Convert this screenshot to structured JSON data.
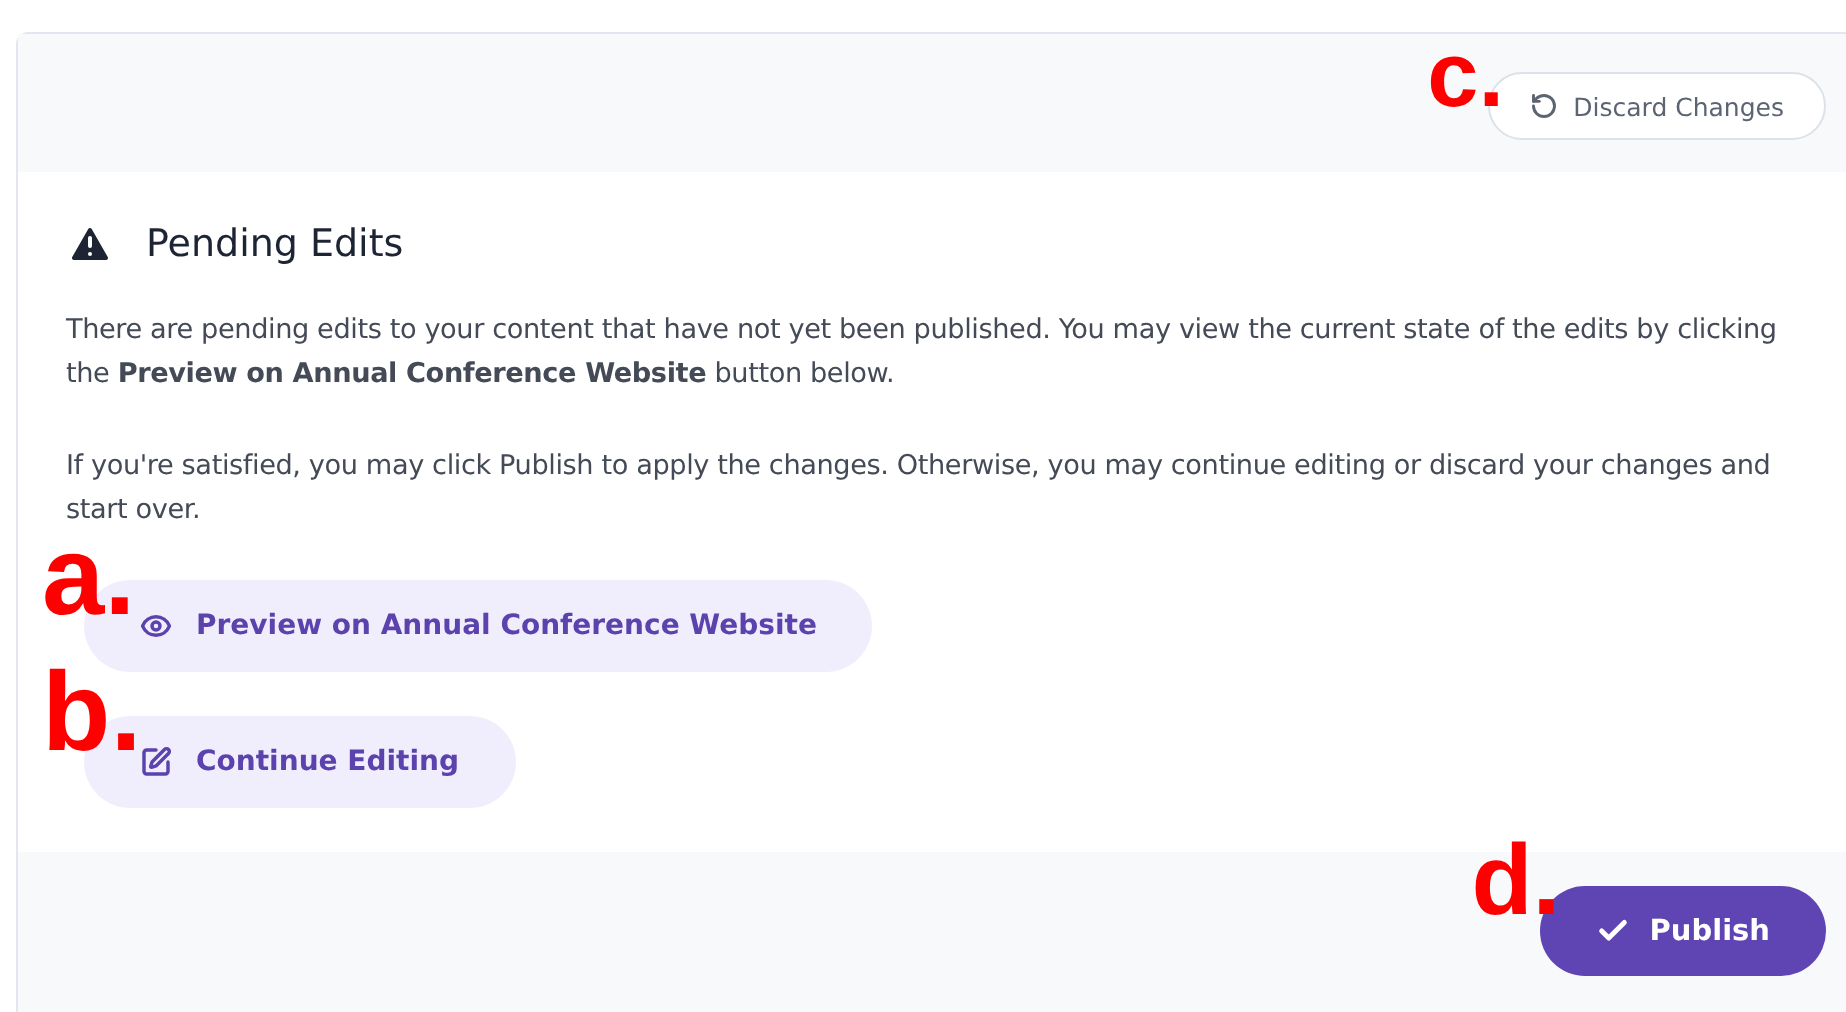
{
  "header": {
    "discard_button": {
      "label": "Discard Changes",
      "marker": "c."
    }
  },
  "notice": {
    "title": "Pending Edits",
    "paragraphs": [
      "There are pending edits to your content that have not yet been published. You may view the current state of the edits by clicking the **Preview on Annual Conference Website** button below.",
      "If you're satisfied, you may click Publish to apply the changes. Otherwise, you may continue editing or discard your changes and start over."
    ]
  },
  "actions": [
    {
      "kind": "preview",
      "label": "Preview on Annual Conference Website",
      "marker": "a."
    },
    {
      "kind": "edit",
      "label": "Continue Editing",
      "marker": "b."
    }
  ],
  "footer": {
    "publish_button": {
      "label": "Publish",
      "marker": "d."
    }
  }
}
